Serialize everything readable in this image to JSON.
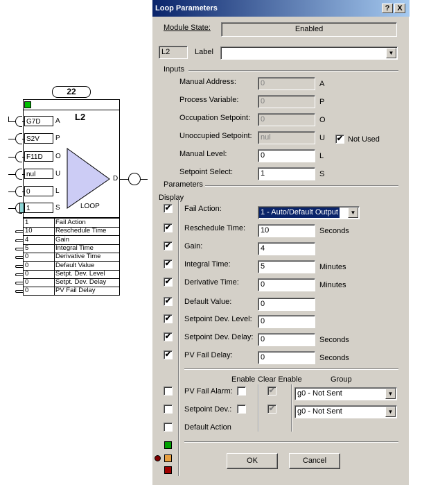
{
  "block": {
    "number": "22",
    "label": "L2",
    "type_label": "LOOP",
    "output_letter": "D",
    "inputs": [
      {
        "value": "G7D",
        "letter": "A"
      },
      {
        "value": "S2V",
        "letter": "P"
      },
      {
        "value": "F11D",
        "letter": "O"
      },
      {
        "value": "nul",
        "letter": "U"
      },
      {
        "value": "0",
        "letter": "L"
      },
      {
        "value": "1",
        "letter": "S"
      }
    ],
    "params": [
      {
        "value": "1",
        "name": "Fail Action"
      },
      {
        "value": "10",
        "name": "Reschedule Time"
      },
      {
        "value": "4",
        "name": "Gain"
      },
      {
        "value": "5",
        "name": "Integral Time"
      },
      {
        "value": "0",
        "name": "Derivative Time"
      },
      {
        "value": "0",
        "name": "Default Value"
      },
      {
        "value": "0",
        "name": "Setpt. Dev. Level"
      },
      {
        "value": "0",
        "name": "Setpt. Dev. Delay"
      },
      {
        "value": "0",
        "name": "PV Fail Delay"
      }
    ]
  },
  "dialog": {
    "title": "Loop Parameters",
    "help_btn": "?",
    "close_btn": "X",
    "module_state_label": "Module State:",
    "module_state_value": "Enabled",
    "loop_id": "L2",
    "label_label": "Label",
    "label_value": "",
    "inputs_group": "Inputs",
    "inputs": [
      {
        "label": "Manual Address:",
        "value": "0",
        "unit": "A",
        "disabled": true
      },
      {
        "label": "Process Variable:",
        "value": "0",
        "unit": "P",
        "disabled": true
      },
      {
        "label": "Occupation Setpoint:",
        "value": "0",
        "unit": "O",
        "disabled": true
      },
      {
        "label": "Unoccupied Setpoint:",
        "value": "nul",
        "unit": "U",
        "disabled": true
      },
      {
        "label": "Manual Level:",
        "value": "0",
        "unit": "L",
        "disabled": false
      },
      {
        "label": "Setpoint Select:",
        "value": "1",
        "unit": "S",
        "disabled": false
      }
    ],
    "not_used_label": "Not Used",
    "not_used_checked": true,
    "parameters_group": "Parameters",
    "display_label": "Display",
    "fail_action_label": "Fail Action:",
    "fail_action_value": "1 - Auto/Default Output",
    "params": [
      {
        "label": "Reschedule Time:",
        "value": "10",
        "unit": "Seconds"
      },
      {
        "label": "Gain:",
        "value": "4",
        "unit": ""
      },
      {
        "label": "Integral Time:",
        "value": "5",
        "unit": "Minutes"
      },
      {
        "label": "Derivative Time:",
        "value": "0",
        "unit": "Minutes"
      },
      {
        "label": "Default Value:",
        "value": "0",
        "unit": ""
      },
      {
        "label": "Setpoint Dev. Level:",
        "value": "0",
        "unit": ""
      },
      {
        "label": "Setpoint Dev. Delay:",
        "value": "0",
        "unit": "Seconds"
      },
      {
        "label": "PV Fail Delay:",
        "value": "0",
        "unit": "Seconds"
      }
    ],
    "alarm_headers": {
      "enable": "Enable",
      "clear_enable": "Clear Enable",
      "group": "Group"
    },
    "alarms": [
      {
        "label": "PV Fail Alarm:",
        "group": "g0  - Not Sent"
      },
      {
        "label": "Setpoint Dev.:",
        "group": "g0  - Not Sent"
      }
    ],
    "default_action_label": "Default Action",
    "check_mark": "✔",
    "ok_label": "OK",
    "cancel_label": "Cancel"
  }
}
